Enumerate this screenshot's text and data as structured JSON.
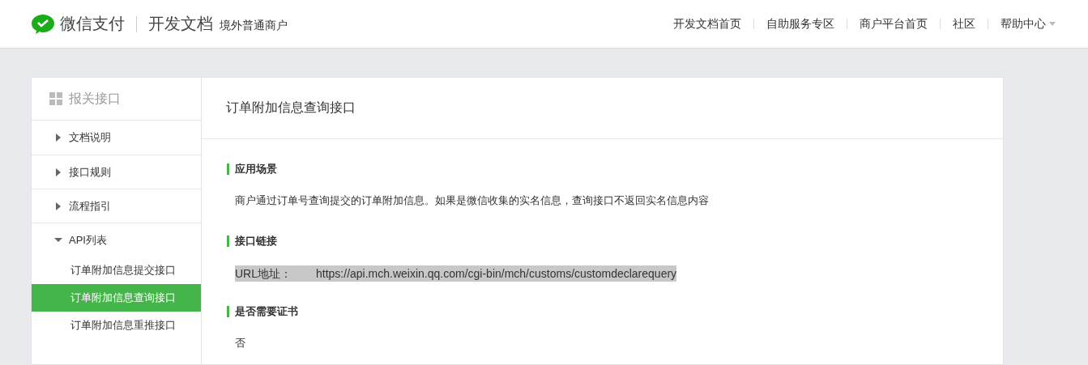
{
  "header": {
    "brand": "微信支付",
    "product": "开发文档",
    "subtitle": "境外普通商户",
    "nav": [
      {
        "label": "开发文档首页",
        "kind": "link"
      },
      {
        "label": "自助服务专区",
        "kind": "link"
      },
      {
        "label": "商户平台首页",
        "kind": "link"
      },
      {
        "label": "社区",
        "kind": "link"
      },
      {
        "label": "帮助中心",
        "kind": "dropdown"
      }
    ]
  },
  "sidebar": {
    "title": "报关接口",
    "sections": [
      {
        "label": "文档说明",
        "expanded": false
      },
      {
        "label": "接口规则",
        "expanded": false
      },
      {
        "label": "流程指引",
        "expanded": false
      },
      {
        "label": "API列表",
        "expanded": true,
        "children": [
          {
            "label": "订单附加信息提交接口",
            "selected": false
          },
          {
            "label": "订单附加信息查询接口",
            "selected": true
          },
          {
            "label": "订单附加信息重推接口",
            "selected": false
          }
        ]
      }
    ]
  },
  "content": {
    "title": "订单附加信息查询接口",
    "sections": [
      {
        "heading": "应用场景",
        "kind": "text",
        "text": "商户通过订单号查询提交的订单附加信息。如果是微信收集的实名信息，查询接口不返回实名信息内容"
      },
      {
        "heading": "接口链接",
        "kind": "url",
        "label": "URL地址：",
        "url": "https://api.mch.weixin.qq.com/cgi-bin/mch/customs/customdeclarequery",
        "highlighted": true
      },
      {
        "heading": "是否需要证书",
        "kind": "text",
        "text": "否"
      }
    ]
  }
}
